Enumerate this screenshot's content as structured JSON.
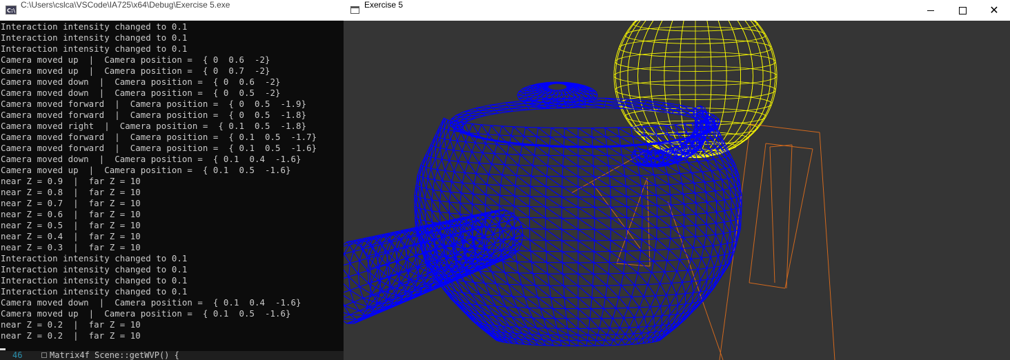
{
  "console": {
    "title": "C:\\Users\\cslca\\VSCode\\IA725\\x64\\Debug\\Exercise 5.exe",
    "icon_label": "C:\\",
    "lines": [
      "Interaction intensity changed to 0.1",
      "Interaction intensity changed to 0.1",
      "Interaction intensity changed to 0.1",
      "Camera moved up  |  Camera position =  { 0  0.6  -2}",
      "Camera moved up  |  Camera position =  { 0  0.7  -2}",
      "Camera moved down  |  Camera position =  { 0  0.6  -2}",
      "Camera moved down  |  Camera position =  { 0  0.5  -2}",
      "Camera moved forward  |  Camera position =  { 0  0.5  -1.9}",
      "Camera moved forward  |  Camera position =  { 0  0.5  -1.8}",
      "Camera moved right  |  Camera position =  { 0.1  0.5  -1.8}",
      "Camera moved forward  |  Camera position =  { 0.1  0.5  -1.7}",
      "Camera moved forward  |  Camera position =  { 0.1  0.5  -1.6}",
      "Camera moved down  |  Camera position =  { 0.1  0.4  -1.6}",
      "Camera moved up  |  Camera position =  { 0.1  0.5  -1.6}",
      "near Z = 0.9  |  far Z = 10",
      "near Z = 0.8  |  far Z = 10",
      "near Z = 0.7  |  far Z = 10",
      "near Z = 0.6  |  far Z = 10",
      "near Z = 0.5  |  far Z = 10",
      "near Z = 0.4  |  far Z = 10",
      "near Z = 0.3  |  far Z = 10",
      "Interaction intensity changed to 0.1",
      "Interaction intensity changed to 0.1",
      "Interaction intensity changed to 0.1",
      "Interaction intensity changed to 0.1",
      "Camera moved down  |  Camera position =  { 0.1  0.4  -1.6}",
      "Camera moved up  |  Camera position =  { 0.1  0.5  -1.6}",
      "near Z = 0.2  |  far Z = 10",
      "near Z = 0.2  |  far Z = 10"
    ]
  },
  "editor": {
    "line_number": "46",
    "code": "Matrix4f Scene::getWVP() {"
  },
  "render_window": {
    "title": "Exercise 5",
    "minimize_glyph": "minimize",
    "maximize_glyph": "maximize",
    "close_glyph": "✕",
    "background": "#353535",
    "objects": [
      {
        "name": "teapot",
        "style": "wireframe",
        "color": "#0000ff"
      },
      {
        "name": "sphere",
        "style": "wireframe",
        "color": "#ffff00"
      },
      {
        "name": "camera-frustum",
        "style": "wireframe",
        "color": "#d2691e"
      }
    ]
  }
}
